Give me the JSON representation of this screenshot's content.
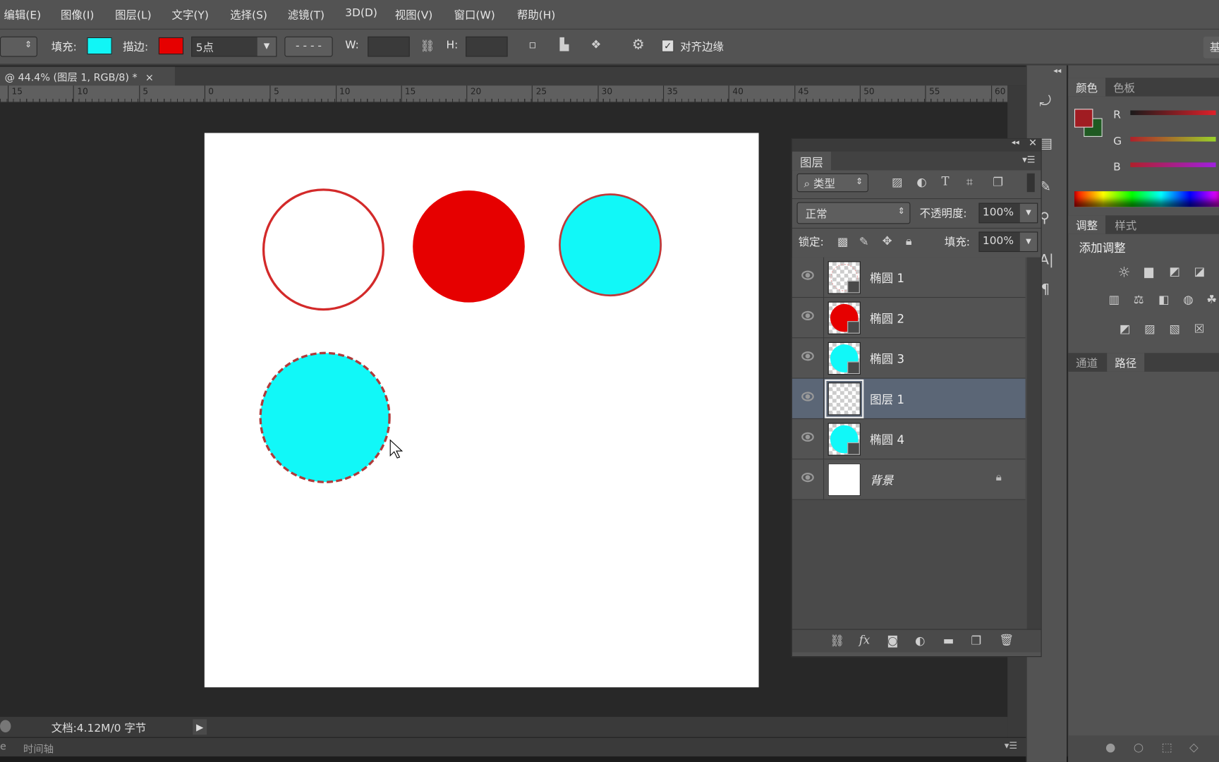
{
  "menu": [
    "编辑(E)",
    "图像(I)",
    "图层(L)",
    "文字(Y)",
    "选择(S)",
    "滤镜(T)",
    "3D(D)",
    "视图(V)",
    "窗口(W)",
    "帮助(H)"
  ],
  "options": {
    "fill_label": "填充:",
    "fill_color": "#11f6f6",
    "stroke_label": "描边:",
    "stroke_color": "#e60000",
    "stroke_width": "5点",
    "w_label": "W:",
    "h_label": "H:",
    "align_edges_label": "对齐边缘",
    "align_edges_checked": true,
    "right_button": "基"
  },
  "document_tab": {
    "title": "@ 44.4% (图层 1, RGB/8) *",
    "close": "×"
  },
  "ruler": [
    "15",
    "10",
    "5",
    "0",
    "5",
    "10",
    "15",
    "20",
    "25",
    "30",
    "35",
    "40",
    "45",
    "50",
    "55",
    "60"
  ],
  "status": {
    "doc_info": "文档:4.12M/0 字节",
    "timeline_label": "时间轴",
    "left_cut": "e"
  },
  "layers_panel": {
    "tab": "图层",
    "filter": "类型",
    "blend_mode": "正常",
    "opacity_label": "不透明度:",
    "opacity": "100%",
    "lock_label": "锁定:",
    "fill_label": "填充:",
    "fill": "100%",
    "layers": [
      {
        "name": "椭圆 1",
        "visible": true,
        "selected": false
      },
      {
        "name": "椭圆 2",
        "visible": true,
        "selected": false
      },
      {
        "name": "椭圆 3",
        "visible": true,
        "selected": false
      },
      {
        "name": "图层 1",
        "visible": true,
        "selected": true
      },
      {
        "name": "椭圆 4",
        "visible": true,
        "selected": false
      },
      {
        "name": "背景",
        "visible": true,
        "selected": false,
        "locked": true
      }
    ]
  },
  "color_panel": {
    "tabs": [
      "颜色",
      "色板"
    ],
    "channels": [
      "R",
      "G",
      "B"
    ],
    "foreground": "#a01c22",
    "background": "#1f5a22"
  },
  "adjust_panel": {
    "tabs": [
      "调整",
      "样式"
    ],
    "title": "添加调整"
  },
  "paths_panel": {
    "tabs": [
      "通道",
      "路径"
    ]
  },
  "canvas_colors": {
    "cyan": "#11f8f8",
    "red": "#e60000",
    "stroke": "#d32a2a"
  }
}
